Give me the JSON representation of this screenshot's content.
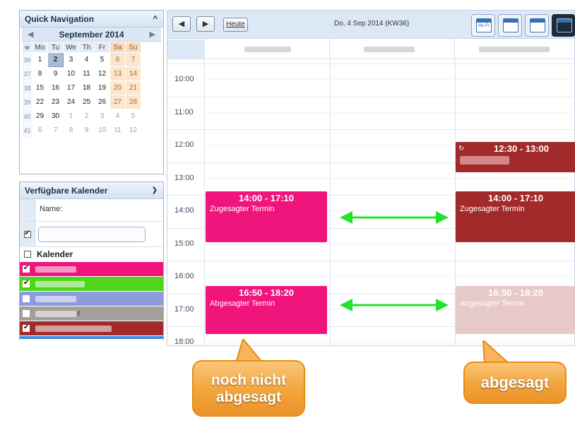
{
  "quick_nav": {
    "title": "Quick Navigation",
    "month_label": "September 2014",
    "prev_icon": "triangle-left-icon",
    "next_icon": "triangle-right-icon",
    "week_header": "w",
    "day_headers": [
      "Mo",
      "Tu",
      "We",
      "Th",
      "Fr",
      "Sa",
      "Su"
    ],
    "weeks": [
      {
        "wk": "36",
        "days": [
          "1",
          "2",
          "3",
          "4",
          "5",
          "6",
          "7"
        ]
      },
      {
        "wk": "37",
        "days": [
          "8",
          "9",
          "10",
          "11",
          "12",
          "13",
          "14"
        ]
      },
      {
        "wk": "38",
        "days": [
          "15",
          "16",
          "17",
          "18",
          "19",
          "20",
          "21"
        ]
      },
      {
        "wk": "39",
        "days": [
          "22",
          "23",
          "24",
          "25",
          "26",
          "27",
          "28"
        ]
      },
      {
        "wk": "40",
        "days": [
          "29",
          "30",
          "1",
          "2",
          "3",
          "4",
          "5"
        ]
      },
      {
        "wk": "41",
        "days": [
          "6",
          "7",
          "8",
          "9",
          "10",
          "11",
          "12"
        ]
      }
    ],
    "selected_day": "2"
  },
  "calendars": {
    "title": "Verfügbare Kalender",
    "name_label": "Name:",
    "group_label": "Kalender",
    "items": [
      {
        "color": "#f0157d",
        "checked": true,
        "name": ""
      },
      {
        "color": "#4fd61c",
        "checked": true,
        "name": ""
      },
      {
        "color": "#8c9bdc",
        "checked": false,
        "name": ""
      },
      {
        "color": "#a3a09b",
        "checked": false,
        "name": "r"
      },
      {
        "color": "#a32a2a",
        "checked": true,
        "name": ""
      }
    ]
  },
  "toolbar": {
    "prev_label": "◀",
    "next_label": "▶",
    "today_label": "Heute",
    "current_date": "Do, 4 Sep 2014 (KW36)",
    "views": [
      {
        "name": "work-week-view-icon",
        "text": "Mo-Fr"
      },
      {
        "name": "day-view-icon",
        "text": ""
      },
      {
        "name": "list-view-icon",
        "text": ""
      },
      {
        "name": "timeline-view-icon",
        "text": ""
      }
    ]
  },
  "grid": {
    "hours": [
      "10:00",
      "11:00",
      "12:00",
      "13:00",
      "14:00",
      "15:00",
      "16:00",
      "17:00",
      "18:00"
    ]
  },
  "events": {
    "left_1": {
      "time": "14:00 - 17:10",
      "title": "Zugesagter Termin",
      "color": "#f0157d"
    },
    "left_2": {
      "time": "16:50 - 18:20",
      "title": "Abgesagter Termin",
      "color": "#f0157d"
    },
    "right_0": {
      "time": "12:30 - 13:00",
      "title": "",
      "color": "#a32a2a"
    },
    "right_1": {
      "time": "14:00 - 17:10",
      "title": "Zugesagter Termin",
      "color": "#a32a2a"
    },
    "right_2": {
      "time": "16:50 - 18:20",
      "title": "Abgesagter Termin",
      "color": "#e8c9c9"
    }
  },
  "annotations": {
    "left_callout": "noch nicht\nabgesagt",
    "right_callout": "abgesagt",
    "arrow_color": "#22e32c",
    "callout_color": "#f2a43a"
  }
}
